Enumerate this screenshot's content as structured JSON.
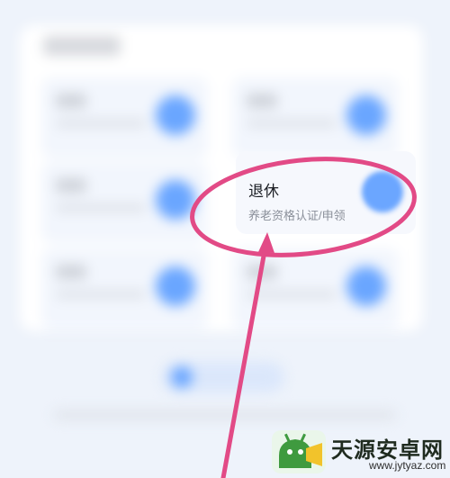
{
  "focus_card": {
    "title": "退休",
    "subtitle": "养老资格认证/申领"
  },
  "watermark": {
    "brand": "天源安卓网",
    "url": "www.jytyaz.com"
  },
  "colors": {
    "highlight": "#e24a86",
    "accent": "#6ba6ff",
    "background": "#eef3fb"
  },
  "icons": {
    "card": "service-icon",
    "watermark": "android-logo-icon"
  }
}
